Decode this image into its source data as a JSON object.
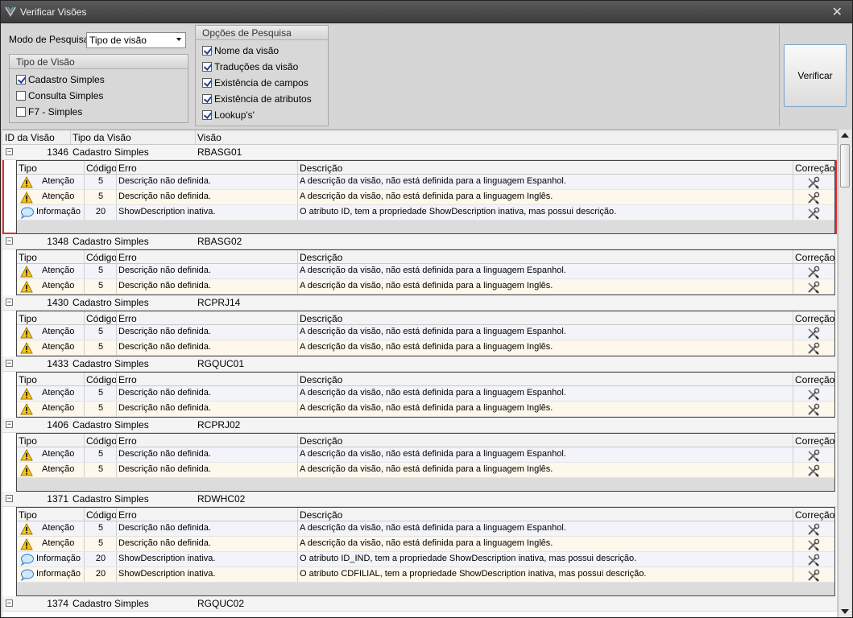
{
  "window": {
    "title": "Verificar Visões",
    "close_glyph": "✕"
  },
  "search": {
    "mode_label": "Modo de Pesquisa:",
    "mode_value": "Tipo de visão"
  },
  "tipo_visao": {
    "title": "Tipo de Visão",
    "options": [
      {
        "label": "Cadastro Simples",
        "checked": true
      },
      {
        "label": "Consulta Simples",
        "checked": false
      },
      {
        "label": "F7 - Simples",
        "checked": false
      }
    ]
  },
  "opcoes": {
    "title": "Opções de Pesquisa",
    "options": [
      {
        "label": "Nome da visão",
        "checked": true
      },
      {
        "label": "Traduções da visão",
        "checked": true
      },
      {
        "label": "Existência de campos",
        "checked": true
      },
      {
        "label": "Existência de atributos",
        "checked": true
      },
      {
        "label": "Lookup's'",
        "checked": true
      }
    ]
  },
  "verify_button": "Verificar",
  "grid": {
    "headers": {
      "id": "ID da Visão",
      "tipo": "Tipo da Visão",
      "visao": "Visão"
    },
    "detail_headers": {
      "tipo": "Tipo",
      "codigo": "Código",
      "erro": "Erro",
      "descricao": "Descrição",
      "correcao": "Correção"
    },
    "groups": [
      {
        "id": "1346",
        "tipo": "Cadastro Simples",
        "visao": "RBASG01",
        "selected": true,
        "footer": true,
        "rows": [
          {
            "kind": "warn",
            "tipo": "Atenção",
            "codigo": "5",
            "erro": "Descrição não definida.",
            "descricao": "A descrição da visão, não está definida para a linguagem Espanhol."
          },
          {
            "kind": "warn",
            "tipo": "Atenção",
            "codigo": "5",
            "erro": "Descrição não definida.",
            "descricao": "A descrição da visão, não está definida para a linguagem Inglês."
          },
          {
            "kind": "info",
            "tipo": "Informação",
            "codigo": "20",
            "erro": "ShowDescription inativa.",
            "descricao": "O atributo ID, tem a propriedade ShowDescription inativa, mas possui descrição."
          }
        ]
      },
      {
        "id": "1348",
        "tipo": "Cadastro Simples",
        "visao": "RBASG02",
        "selected": false,
        "footer": false,
        "rows": [
          {
            "kind": "warn",
            "tipo": "Atenção",
            "codigo": "5",
            "erro": "Descrição não definida.",
            "descricao": "A descrição da visão, não está definida para a linguagem Espanhol."
          },
          {
            "kind": "warn",
            "tipo": "Atenção",
            "codigo": "5",
            "erro": "Descrição não definida.",
            "descricao": "A descrição da visão, não está definida para a linguagem Inglês."
          }
        ]
      },
      {
        "id": "1430",
        "tipo": "Cadastro Simples",
        "visao": "RCPRJ14",
        "selected": false,
        "footer": false,
        "rows": [
          {
            "kind": "warn",
            "tipo": "Atenção",
            "codigo": "5",
            "erro": "Descrição não definida.",
            "descricao": "A descrição da visão, não está definida para a linguagem Espanhol."
          },
          {
            "kind": "warn",
            "tipo": "Atenção",
            "codigo": "5",
            "erro": "Descrição não definida.",
            "descricao": "A descrição da visão, não está definida para a linguagem Inglês."
          }
        ]
      },
      {
        "id": "1433",
        "tipo": "Cadastro Simples",
        "visao": "RGQUC01",
        "selected": false,
        "footer": false,
        "rows": [
          {
            "kind": "warn",
            "tipo": "Atenção",
            "codigo": "5",
            "erro": "Descrição não definida.",
            "descricao": "A descrição da visão, não está definida para a linguagem Espanhol."
          },
          {
            "kind": "warn",
            "tipo": "Atenção",
            "codigo": "5",
            "erro": "Descrição não definida.",
            "descricao": "A descrição da visão, não está definida para a linguagem Inglês."
          }
        ]
      },
      {
        "id": "1406",
        "tipo": "Cadastro Simples",
        "visao": "RCPRJ02",
        "selected": false,
        "footer": true,
        "rows": [
          {
            "kind": "warn",
            "tipo": "Atenção",
            "codigo": "5",
            "erro": "Descrição não definida.",
            "descricao": "A descrição da visão, não está definida para a linguagem Espanhol."
          },
          {
            "kind": "warn",
            "tipo": "Atenção",
            "codigo": "5",
            "erro": "Descrição não definida.",
            "descricao": "A descrição da visão, não está definida para a linguagem Inglês."
          }
        ]
      },
      {
        "id": "1371",
        "tipo": "Cadastro Simples",
        "visao": "RDWHC02",
        "selected": false,
        "footer": true,
        "rows": [
          {
            "kind": "warn",
            "tipo": "Atenção",
            "codigo": "5",
            "erro": "Descrição não definida.",
            "descricao": "A descrição da visão, não está definida para a linguagem Espanhol."
          },
          {
            "kind": "warn",
            "tipo": "Atenção",
            "codigo": "5",
            "erro": "Descrição não definida.",
            "descricao": "A descrição da visão, não está definida para a linguagem Inglês."
          },
          {
            "kind": "info",
            "tipo": "Informação",
            "codigo": "20",
            "erro": "ShowDescription inativa.",
            "descricao": "O atributo ID_IND, tem a propriedade ShowDescription inativa, mas possui descrição."
          },
          {
            "kind": "info",
            "tipo": "Informação",
            "codigo": "20",
            "erro": "ShowDescription inativa.",
            "descricao": "O atributo CDFILIAL, tem a propriedade ShowDescription inativa, mas possui descrição."
          }
        ]
      },
      {
        "id": "1374",
        "tipo": "Cadastro Simples",
        "visao": "RGQUC02",
        "selected": false,
        "footer": false,
        "rows": []
      }
    ]
  },
  "icons": {
    "warning": "warning-icon",
    "info": "info-bubble-icon",
    "fix": "wrench-screwdriver-icon",
    "collapse": "⊟"
  },
  "colors": {
    "selection": "#e03030",
    "titlebar": "#3c3c3c",
    "button_border": "#7ea3c4"
  }
}
